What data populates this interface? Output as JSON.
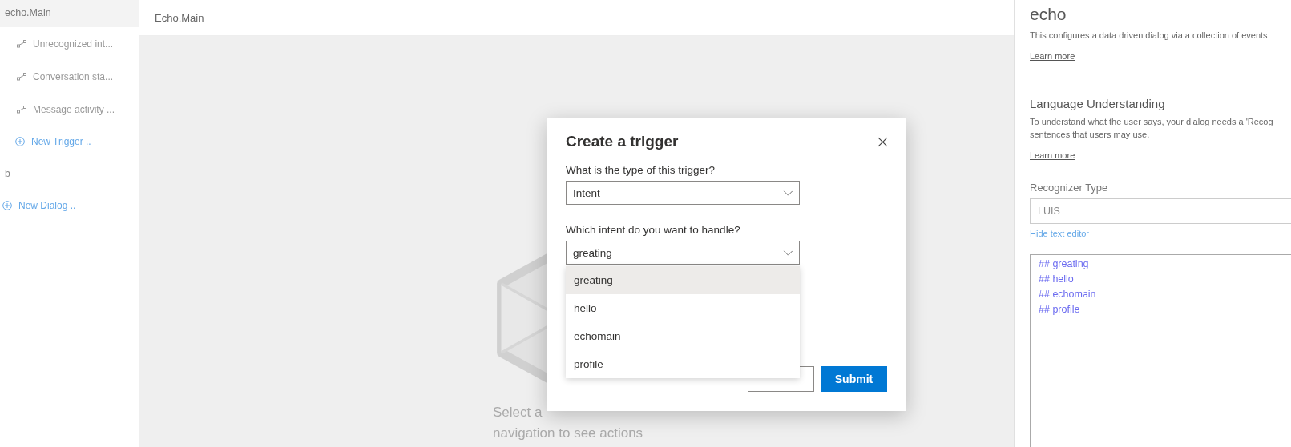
{
  "sidebar": {
    "dialog": {
      "label": "echo.Main",
      "selected": true
    },
    "triggers": [
      {
        "label": "Unrecognized int..."
      },
      {
        "label": "Conversation sta..."
      },
      {
        "label": "Message activity ..."
      }
    ],
    "new_trigger": "New Trigger ..",
    "dialogs": [
      {
        "label": "b",
        "selected": false
      }
    ],
    "new_dialog": "New Dialog .."
  },
  "canvas": {
    "title": "Echo.Main",
    "empty_text": [
      "Select a",
      "navigation to see actions"
    ]
  },
  "modal": {
    "title": "Create a trigger",
    "type_label": "What is the type of this trigger?",
    "type_value": "Intent",
    "intent_label": "Which intent do you want to handle?",
    "intent_value": "greating",
    "options": [
      {
        "label": "greating",
        "selected": true
      },
      {
        "label": "hello",
        "selected": false
      },
      {
        "label": "echomain",
        "selected": false
      },
      {
        "label": "profile",
        "selected": false
      }
    ],
    "submit": "Submit"
  },
  "properties": {
    "title": "echo",
    "description": "This configures a data driven dialog via a collection of events",
    "learn_more": "Learn more",
    "lu_title": "Language Understanding",
    "lu_description": [
      "To understand what the user says, your dialog needs a 'Recog",
      "sentences that users may use."
    ],
    "lu_learn_more": "Learn more",
    "recognizer_label": "Recognizer Type",
    "recognizer_value": "LUIS",
    "hide_editor": "Hide text editor",
    "editor_lines": [
      "## greating",
      "## hello",
      "## echomain",
      "## profile"
    ]
  }
}
